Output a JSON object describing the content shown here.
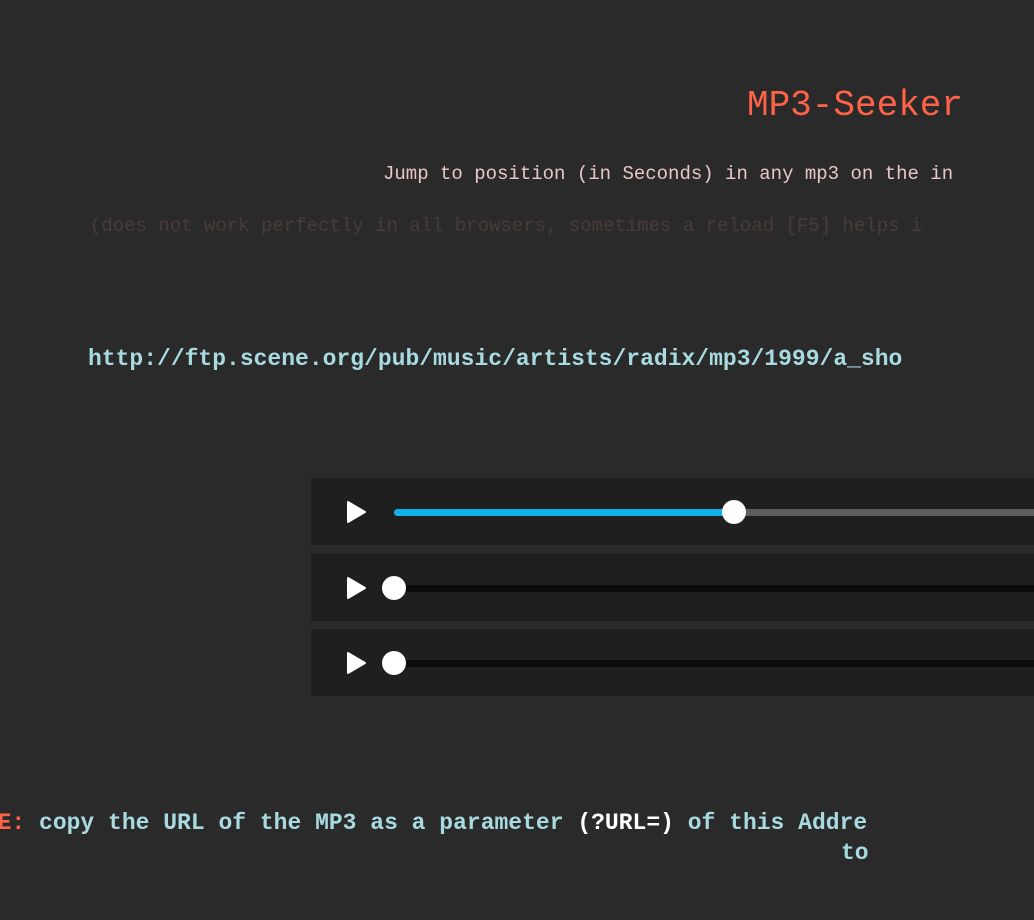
{
  "header": {
    "title": "MP3-Seeker",
    "subtitle": "Jump to position (in Seconds) in any mp3 on the in",
    "note": "(does not work perfectly in all browsers, sometimes a reload [F5] helps i"
  },
  "mp3_url": "http://ftp.scene.org/pub/music/artists/radix/mp3/1999/a_sho",
  "players": [
    {
      "progress": 0.5
    },
    {
      "progress": 0
    },
    {
      "progress": 0
    }
  ],
  "usage": {
    "label": "AGE:",
    "text_before": " copy the URL of the MP3 as a parameter ",
    "param": "(?URL=)",
    "text_after": " of this Addre",
    "continuation": "to"
  },
  "colors": {
    "accent": "#ff6347",
    "progress": "#12b0e8",
    "link": "#a8dbe0",
    "background": "#2a2a2a"
  },
  "icons": {
    "play": "play-icon"
  }
}
